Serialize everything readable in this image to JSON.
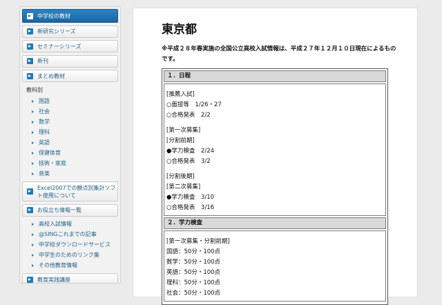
{
  "sidebar": {
    "main_items": [
      {
        "label": "中学校の教材"
      },
      {
        "label": "新研究シリーズ"
      },
      {
        "label": "セミナーシリーズ"
      },
      {
        "label": "新刊"
      },
      {
        "label": "まとめ教材"
      }
    ],
    "subject_heading": "教科別",
    "subjects": [
      "国語",
      "社会",
      "数学",
      "理科",
      "英語",
      "保健体育",
      "技術・家庭",
      "音楽"
    ],
    "excel_item": "Excel2007での観点別集計ソフト使用について",
    "info_item": "お役立ち情報一覧",
    "info_subs": [
      "高校入試情報",
      "@SINGこれまでの記事",
      "中学校ダウンロードサービス",
      "中学生のためのリンク集",
      "その他教育情報"
    ],
    "seminar_item": "教育実践講座"
  },
  "main": {
    "title": "東京都",
    "notice": "※平成２８年春実施の全国公立高校入試情報は、平成２７年１２月１０日現在によるものです。",
    "sections": [
      {
        "heading": "１．日程",
        "groups": [
          [
            "[推薦入試]",
            "○面接等　1/26・27",
            "○合格発表　2/2"
          ],
          [
            "[第一次募集]",
            "[分割前期]",
            "●学力検査　2/24",
            "○合格発表　3/2"
          ],
          [
            "[分割後期]",
            "[第二次募集]",
            "●学力検査　3/10",
            "○合格発表　3/16"
          ]
        ]
      },
      {
        "heading": "２．学力検査",
        "groups": [
          [
            "[第一次募集・分割前期]",
            "国語：50分・100点",
            "数学：50分・100点",
            "英語：50分・100点",
            "理科：50分・100点",
            "社会：50分・100点"
          ]
        ]
      }
    ]
  }
}
